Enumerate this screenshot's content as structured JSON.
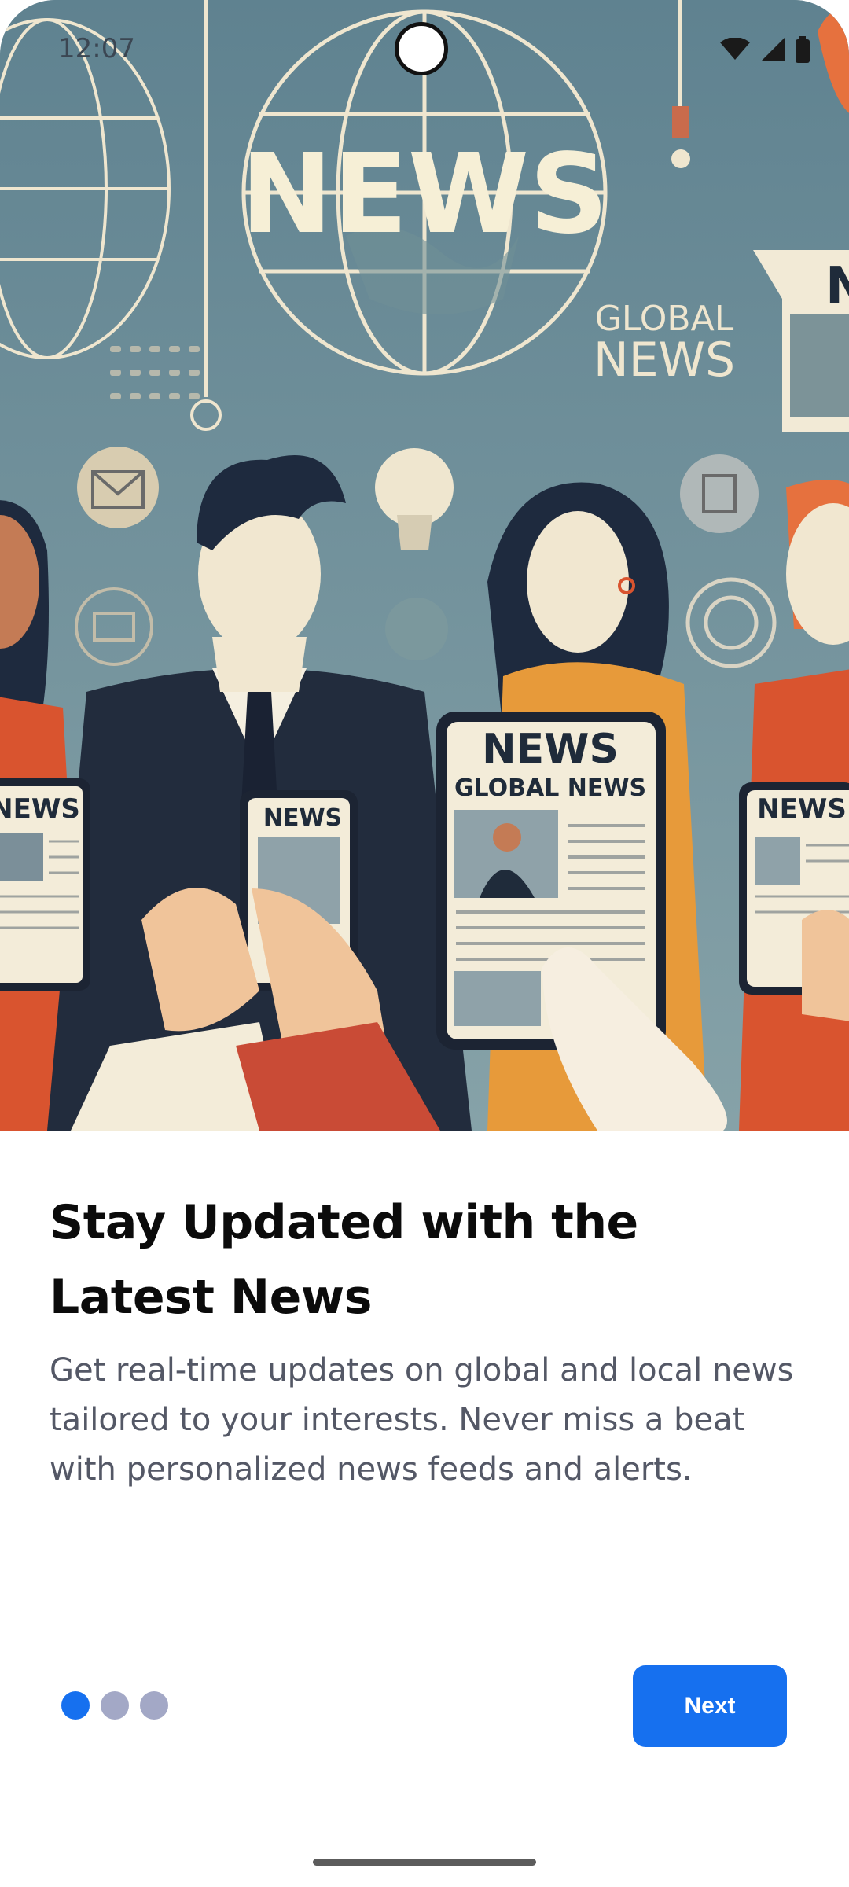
{
  "status_bar": {
    "time": "12:07",
    "icons": [
      "wifi-icon",
      "signal-icon",
      "battery-icon"
    ]
  },
  "hero": {
    "image_name": "news-readers-illustration",
    "news_word": "NEWS",
    "global_news_line1": "GLOBAL",
    "global_news_line2": "NEWS",
    "phone_center_title": "NEWS",
    "phone_center_subtitle": "GLOBAL NEWS",
    "phone_small_title": "NEWS",
    "phone_left_title": "NEWS",
    "phone_right_title": "NEWS",
    "sign_right_title": "N"
  },
  "onboarding": {
    "title": "Stay Updated with the Latest News",
    "description": "Get real-time updates on global and local news tailored to your interests. Never miss a beat with personalized news feeds and alerts.",
    "page_count": 3,
    "current_page": 1
  },
  "actions": {
    "next_label": "Next"
  },
  "colors": {
    "accent": "#1670ef",
    "dot_inactive": "#a3a8c6",
    "title": "#0b0b0b",
    "description": "#545866"
  }
}
